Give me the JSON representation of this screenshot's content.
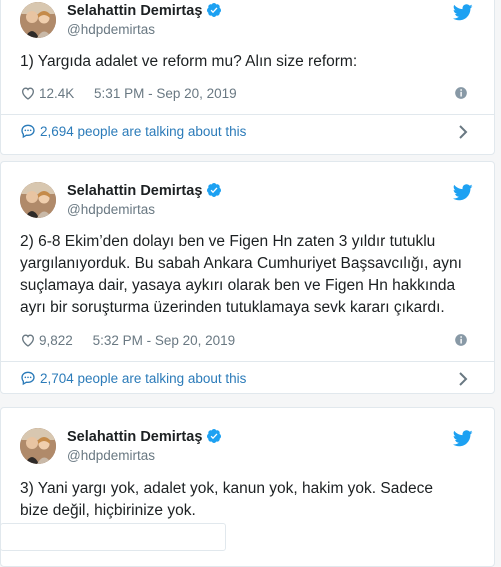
{
  "colors": {
    "twitter_blue": "#1da1f2",
    "link": "#2b7bb9",
    "muted": "#697882",
    "text": "#1c2022"
  },
  "tweets": [
    {
      "author": {
        "name": "Selahattin Demirtaş",
        "handle": "@hdpdemirtas",
        "verified": true
      },
      "text": "1) Yargıda adalet ve reform mu? Alın size reform:",
      "likes": "12.4K",
      "timestamp": "5:31 PM - Sep 20, 2019",
      "conversation": "2,694 people are talking about this"
    },
    {
      "author": {
        "name": "Selahattin Demirtaş",
        "handle": "@hdpdemirtas",
        "verified": true
      },
      "text": "2) 6-8 Ekim’den dolayı ben ve Figen Hn zaten 3 yıldır tutuklu\nyargılanıyorduk. Bu sabah Ankara Cumhuriyet Başsavcılığı, aynı\nsuçlamaya dair, yasaya aykırı olarak ben ve Figen Hn hakkında\nayrı bir soruşturma üzerinden tutuklamaya sevk kararı çıkardı.",
      "likes": "9,822",
      "timestamp": "5:32 PM - Sep 20, 2019",
      "conversation": "2,704 people are talking about this"
    },
    {
      "author": {
        "name": "Selahattin Demirtaş",
        "handle": "@hdpdemirtas",
        "verified": true
      },
      "text": "3) Yani yargı yok, adalet yok, kanun yok, hakim yok. Sadece\nbize değil, hiçbirinize yok.",
      "likes": "",
      "timestamp": "",
      "conversation": ""
    }
  ]
}
